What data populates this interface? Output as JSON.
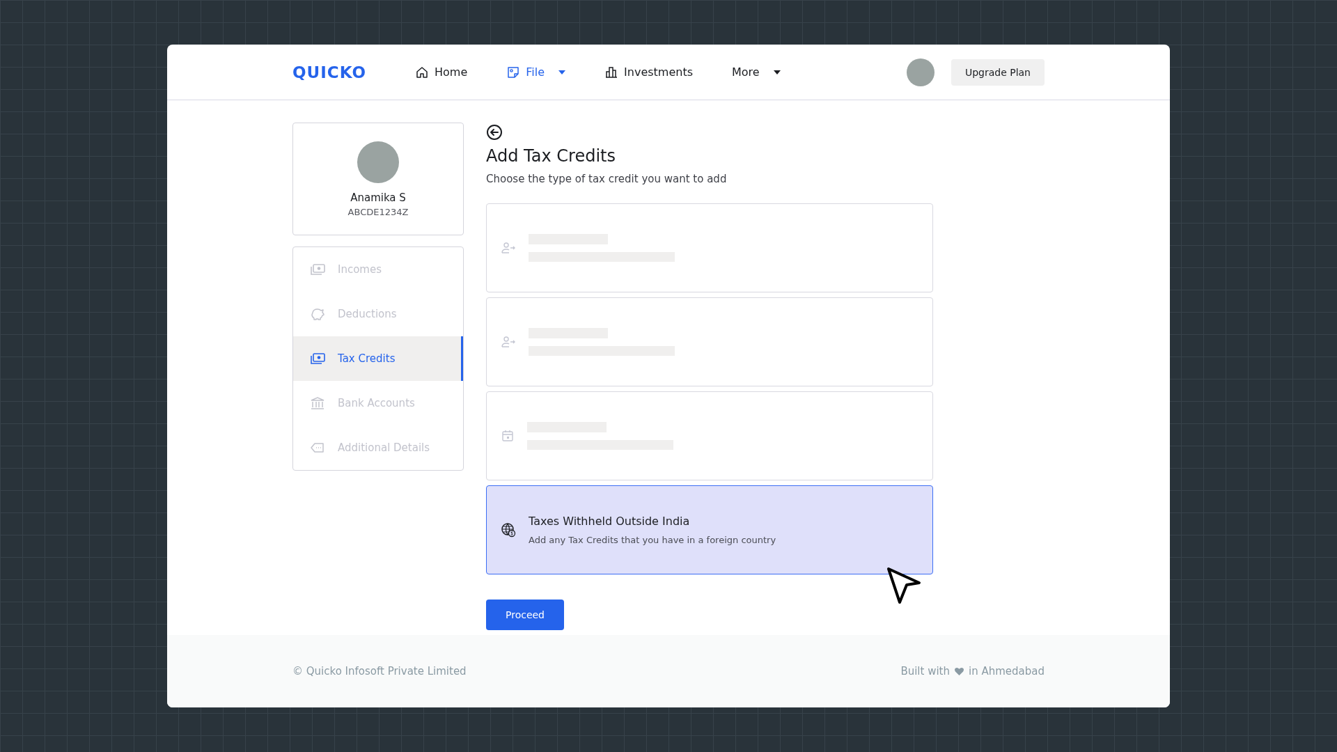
{
  "header": {
    "logo": "QUICKO",
    "nav": [
      {
        "label": "Home",
        "kind": "home",
        "selected": false,
        "dropdown": false
      },
      {
        "label": "File",
        "kind": "file",
        "selected": true,
        "dropdown": true
      },
      {
        "label": "Investments",
        "kind": "chart",
        "selected": false,
        "dropdown": false
      },
      {
        "label": "More",
        "kind": "none",
        "selected": false,
        "dropdown": true
      }
    ],
    "upgrade_button": "Upgrade Plan"
  },
  "profile": {
    "name": "Anamika S",
    "pan": "ABCDE1234Z"
  },
  "sidebar": {
    "items": [
      {
        "label": "Incomes",
        "kind": "money",
        "selected": false
      },
      {
        "label": "Deductions",
        "kind": "piggy",
        "selected": false
      },
      {
        "label": "Tax Credits",
        "kind": "money",
        "selected": true
      },
      {
        "label": "Bank Accounts",
        "kind": "bank",
        "selected": false
      },
      {
        "label": "Additional Details",
        "kind": "tag",
        "selected": false
      }
    ]
  },
  "main": {
    "title": "Add Tax Credits",
    "subtitle": "Choose the type of tax credit you want to add",
    "options": [
      {
        "kind": "skeleton",
        "selected": false
      },
      {
        "kind": "skeleton",
        "selected": false
      },
      {
        "kind": "skeleton",
        "selected": false
      },
      {
        "kind": "option",
        "title": "Taxes Withheld Outside India",
        "description": "Add any Tax Credits that you have in a foreign country",
        "selected": true
      }
    ],
    "proceed_button": "Proceed"
  },
  "footer": {
    "copyright": "© Quicko Infosoft Private Limited",
    "built_with": "Built with",
    "location": "in Ahmedabad"
  }
}
